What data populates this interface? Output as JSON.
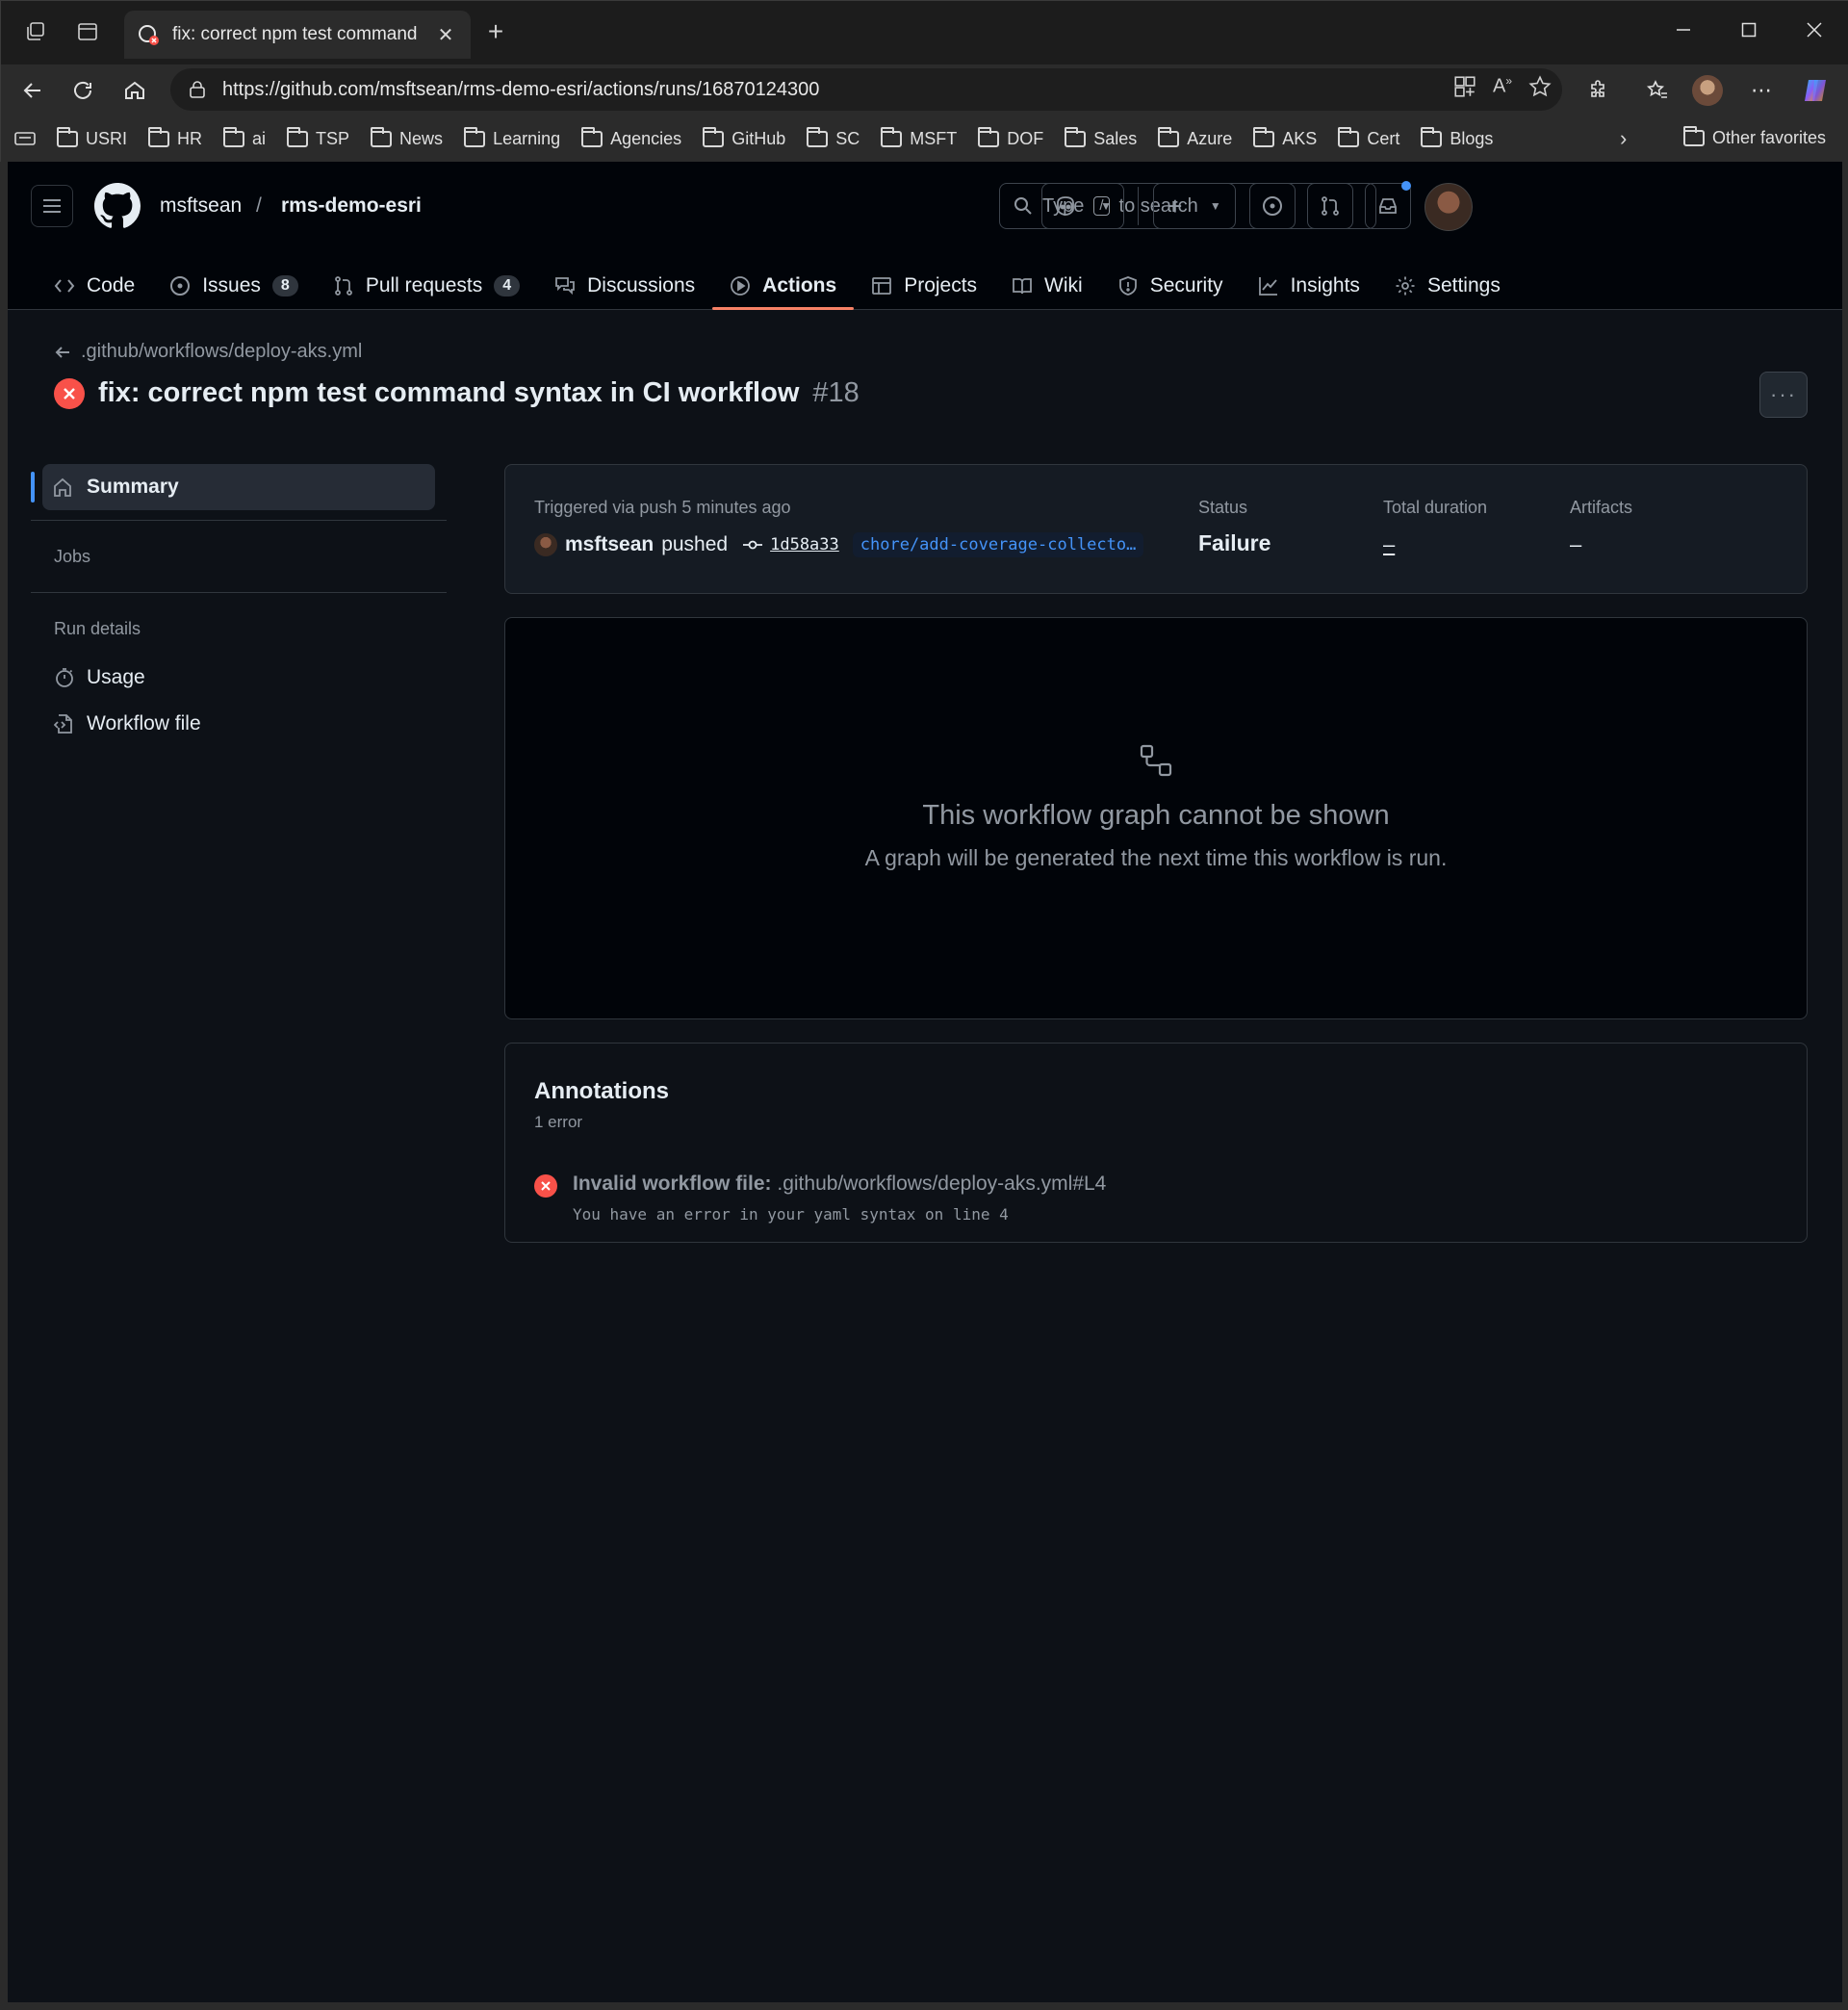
{
  "browser": {
    "tab_title": "fix: correct npm test command syntax in CI workflow",
    "url": "https://github.com/msftsean/rms-demo-esri/actions/runs/16870124300",
    "bookmarks": [
      "USRI",
      "HR",
      "ai",
      "TSP",
      "News",
      "Learning",
      "Agencies",
      "GitHub",
      "SC",
      "MSFT",
      "DOF",
      "Sales",
      "Azure",
      "AKS",
      "Cert",
      "Blogs"
    ],
    "other_favorites": "Other favorites"
  },
  "header": {
    "owner": "msftsean",
    "separator": "/",
    "repo": "rms-demo-esri",
    "search_prefix": "Type",
    "search_key": "/",
    "search_suffix": "to search"
  },
  "reponav": {
    "code": "Code",
    "issues": "Issues",
    "issues_count": "8",
    "pulls": "Pull requests",
    "pulls_count": "4",
    "discussions": "Discussions",
    "actions": "Actions",
    "projects": "Projects",
    "wiki": "Wiki",
    "security": "Security",
    "insights": "Insights",
    "settings": "Settings"
  },
  "run": {
    "back_link": ".github/workflows/deploy-aks.yml",
    "title": "fix: correct npm test command syntax in CI workflow",
    "number": "#18"
  },
  "sidebar": {
    "summary": "Summary",
    "jobs": "Jobs",
    "run_details": "Run details",
    "usage": "Usage",
    "workflow_file": "Workflow file"
  },
  "summary": {
    "trigger": "Triggered via push 5 minutes ago",
    "actor": "msftsean",
    "action": "pushed",
    "sha": "1d58a33",
    "branch": "chore/add-coverage-collecto…",
    "status_label": "Status",
    "status_value": "Failure",
    "duration_label": "Total duration",
    "duration_value": "–",
    "artifacts_label": "Artifacts",
    "artifacts_value": "–"
  },
  "graph": {
    "heading": "This workflow graph cannot be shown",
    "text": "A graph will be generated the next time this workflow is run."
  },
  "annotations": {
    "title": "Annotations",
    "count": "1 error",
    "error_title": "Invalid workflow file:",
    "error_path": ".github/workflows/deploy-aks.yml#L4",
    "error_message": "You have an error in your yaml syntax on line 4"
  },
  "colors": {
    "page_bg": "#0d1117",
    "header_bg": "#010409",
    "failure": "#f85149",
    "active_underline": "#f78166",
    "accent_blue": "#4493f8"
  }
}
